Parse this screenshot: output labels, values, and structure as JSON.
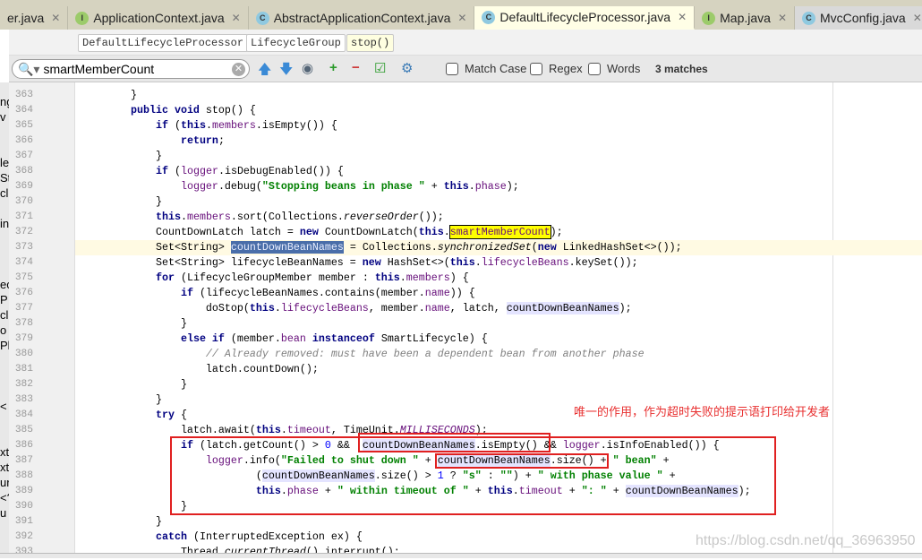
{
  "tabs": [
    {
      "label": "er.java",
      "icon": "none"
    },
    {
      "label": "ApplicationContext.java",
      "icon": "interface",
      "badge": "I"
    },
    {
      "label": "AbstractApplicationContext.java",
      "icon": "class",
      "badge": "C"
    },
    {
      "label": "DefaultLifecycleProcessor.java",
      "icon": "class",
      "badge": "C",
      "active": true
    },
    {
      "label": "Map.java",
      "icon": "interface",
      "badge": "I"
    },
    {
      "label": "MvcConfig.java",
      "icon": "class",
      "badge": "C"
    }
  ],
  "breadcrumbs": [
    "DefaultLifecycleProcessor",
    "LifecycleGroup",
    "stop()"
  ],
  "search": {
    "value": "smartMemberCount",
    "options": [
      "Match Case",
      "Regex",
      "Words"
    ],
    "matches": "3 matches"
  },
  "tree_fragments": [
    "ng",
    "v",
    "le",
    "St",
    "cl",
    "int",
    "ec",
    "P",
    "cl",
    "o",
    "Ph",
    "<",
    "xt",
    "xt",
    "ur",
    "<?",
    "u"
  ],
  "annotation": "唯一的作用，作为超时失败的提示语打印给开发者",
  "watermark": "https://blog.csdn.net/qq_36963950",
  "colors": {
    "keyword": "#000080",
    "field": "#660e7a",
    "string": "#008000",
    "number": "#0000ff",
    "comment": "#808080",
    "search_match": "#ffff00",
    "annotation": "#e83030"
  },
  "code": {
    "lines": [
      {
        "n": "363",
        "t": [
          [
            "",
            "    }"
          ]
        ]
      },
      {
        "n": "364",
        "t": [
          [
            "",
            "    "
          ],
          [
            "kw",
            "public void"
          ],
          [
            "",
            " stop() {"
          ]
        ]
      },
      {
        "n": "365",
        "t": [
          [
            "",
            "        "
          ],
          [
            "kw",
            "if"
          ],
          [
            "",
            " ("
          ],
          [
            "kw",
            "this"
          ],
          [
            "",
            "."
          ],
          [
            "fld",
            "members"
          ],
          [
            "",
            ".isEmpty()) {"
          ]
        ]
      },
      {
        "n": "366",
        "t": [
          [
            "",
            "            "
          ],
          [
            "kw",
            "return"
          ],
          [
            "",
            ";"
          ]
        ]
      },
      {
        "n": "367",
        "t": [
          [
            "",
            "        }"
          ]
        ]
      },
      {
        "n": "368",
        "t": [
          [
            "",
            "        "
          ],
          [
            "kw",
            "if"
          ],
          [
            "",
            " ("
          ],
          [
            "fld",
            "logger"
          ],
          [
            "",
            ".isDebugEnabled()) {"
          ]
        ]
      },
      {
        "n": "369",
        "t": [
          [
            "",
            "            "
          ],
          [
            "fld",
            "logger"
          ],
          [
            "",
            ".debug("
          ],
          [
            "str",
            "\"Stopping beans in phase \""
          ],
          [
            "",
            " + "
          ],
          [
            "kw",
            "this"
          ],
          [
            "",
            "."
          ],
          [
            "fld",
            "phase"
          ],
          [
            "",
            ");"
          ]
        ]
      },
      {
        "n": "370",
        "t": [
          [
            "",
            "        }"
          ]
        ]
      },
      {
        "n": "371",
        "t": [
          [
            "",
            "        "
          ],
          [
            "kw",
            "this"
          ],
          [
            "",
            "."
          ],
          [
            "fld",
            "members"
          ],
          [
            "",
            ".sort(Collections."
          ],
          [
            "it",
            "reverseOrder"
          ],
          [
            "",
            "());"
          ]
        ]
      },
      {
        "n": "372",
        "t": [
          [
            "",
            "        CountDownLatch latch = "
          ],
          [
            "kw",
            "new"
          ],
          [
            "",
            " CountDownLatch("
          ],
          [
            "kw",
            "this"
          ],
          [
            "",
            "."
          ],
          [
            "fld hl",
            "smartMemberCount"
          ],
          [
            "",
            ");"
          ]
        ]
      },
      {
        "n": "373",
        "current": true,
        "t": [
          [
            "",
            "        Set<String> "
          ],
          [
            "sel",
            "countDownBeanNames"
          ],
          [
            "",
            " = Collections."
          ],
          [
            "it",
            "synchronizedSet"
          ],
          [
            "",
            "("
          ],
          [
            "kw",
            "new"
          ],
          [
            "",
            " LinkedHashSet<>());"
          ]
        ]
      },
      {
        "n": "374",
        "t": [
          [
            "",
            "        Set<String> lifecycleBeanNames = "
          ],
          [
            "kw",
            "new"
          ],
          [
            "",
            " HashSet<>("
          ],
          [
            "kw",
            "this"
          ],
          [
            "",
            "."
          ],
          [
            "fld",
            "lifecycleBeans"
          ],
          [
            "",
            ".keySet());"
          ]
        ]
      },
      {
        "n": "375",
        "t": [
          [
            "",
            "        "
          ],
          [
            "kw",
            "for"
          ],
          [
            "",
            " (LifecycleGroupMember member : "
          ],
          [
            "kw",
            "this"
          ],
          [
            "",
            "."
          ],
          [
            "fld",
            "members"
          ],
          [
            "",
            ") {"
          ]
        ]
      },
      {
        "n": "376",
        "t": [
          [
            "",
            "            "
          ],
          [
            "kw",
            "if"
          ],
          [
            "",
            " (lifecycleBeanNames.contains(member."
          ],
          [
            "fld",
            "name"
          ],
          [
            "",
            ")) {"
          ]
        ]
      },
      {
        "n": "377",
        "t": [
          [
            "",
            "                doStop("
          ],
          [
            "kw",
            "this"
          ],
          [
            "",
            "."
          ],
          [
            "fld",
            "lifecycleBeans"
          ],
          [
            "",
            ", member."
          ],
          [
            "fld",
            "name"
          ],
          [
            "",
            ", latch, "
          ],
          [
            "use",
            "countDownBeanNames"
          ],
          [
            "",
            ");"
          ]
        ]
      },
      {
        "n": "378",
        "t": [
          [
            "",
            "            }"
          ]
        ]
      },
      {
        "n": "379",
        "t": [
          [
            "",
            "            "
          ],
          [
            "kw",
            "else if"
          ],
          [
            "",
            " (member."
          ],
          [
            "fld",
            "bean"
          ],
          [
            "",
            " "
          ],
          [
            "kw",
            "instanceof"
          ],
          [
            "",
            " SmartLifecycle) {"
          ]
        ]
      },
      {
        "n": "380",
        "t": [
          [
            "",
            "                "
          ],
          [
            "cm",
            "// Already removed: must have been a dependent bean from another phase"
          ]
        ]
      },
      {
        "n": "381",
        "t": [
          [
            "",
            "                latch.countDown();"
          ]
        ]
      },
      {
        "n": "382",
        "t": [
          [
            "",
            "            }"
          ]
        ]
      },
      {
        "n": "383",
        "t": [
          [
            "",
            "        }"
          ]
        ]
      },
      {
        "n": "384",
        "t": [
          [
            "",
            "        "
          ],
          [
            "kw",
            "try"
          ],
          [
            "",
            " {"
          ]
        ]
      },
      {
        "n": "385",
        "t": [
          [
            "",
            "            latch.await("
          ],
          [
            "kw",
            "this"
          ],
          [
            "",
            "."
          ],
          [
            "fld",
            "timeout"
          ],
          [
            "",
            ", TimeUnit."
          ],
          [
            "itf",
            "MILLISECONDS"
          ],
          [
            "",
            ");"
          ]
        ]
      },
      {
        "n": "386",
        "t": [
          [
            "",
            "            "
          ],
          [
            "kw",
            "if"
          ],
          [
            "",
            " (latch.getCount() > "
          ],
          [
            "num",
            "0"
          ],
          [
            "",
            " && !"
          ],
          [
            "use",
            "countDownBeanNames"
          ],
          [
            "",
            ".isEmpty() && "
          ],
          [
            "fld",
            "logger"
          ],
          [
            "",
            ".isInfoEnabled()) {"
          ]
        ]
      },
      {
        "n": "387",
        "t": [
          [
            "",
            "                "
          ],
          [
            "fld",
            "logger"
          ],
          [
            "",
            ".info("
          ],
          [
            "str",
            "\"Failed to shut down \""
          ],
          [
            "",
            " + "
          ],
          [
            "use",
            "countDownBeanNames"
          ],
          [
            "",
            ".size() + "
          ],
          [
            "str",
            "\" bean\""
          ],
          [
            "",
            " +"
          ]
        ]
      },
      {
        "n": "388",
        "t": [
          [
            "",
            "                        ("
          ],
          [
            "use",
            "countDownBeanNames"
          ],
          [
            "",
            ".size() > "
          ],
          [
            "num",
            "1"
          ],
          [
            "",
            " ? "
          ],
          [
            "str",
            "\"s\""
          ],
          [
            "",
            " : "
          ],
          [
            "str",
            "\"\""
          ],
          [
            "",
            ") + "
          ],
          [
            "str",
            "\" with phase value \""
          ],
          [
            "",
            " +"
          ]
        ]
      },
      {
        "n": "389",
        "t": [
          [
            "",
            "                        "
          ],
          [
            "kw",
            "this"
          ],
          [
            "",
            "."
          ],
          [
            "fld",
            "phase"
          ],
          [
            "",
            " + "
          ],
          [
            "str",
            "\" within timeout of \""
          ],
          [
            "",
            " + "
          ],
          [
            "kw",
            "this"
          ],
          [
            "",
            "."
          ],
          [
            "fld",
            "timeout"
          ],
          [
            "",
            " + "
          ],
          [
            "str",
            "\": \""
          ],
          [
            "",
            " + "
          ],
          [
            "use",
            "countDownBeanNames"
          ],
          [
            "",
            ");"
          ]
        ]
      },
      {
        "n": "390",
        "t": [
          [
            "",
            "            }"
          ]
        ]
      },
      {
        "n": "391",
        "t": [
          [
            "",
            "        }"
          ]
        ]
      },
      {
        "n": "392",
        "t": [
          [
            "",
            "        "
          ],
          [
            "kw",
            "catch"
          ],
          [
            "",
            " (InterruptedException ex) {"
          ]
        ]
      },
      {
        "n": "393",
        "t": [
          [
            "",
            "            Thread."
          ],
          [
            "it",
            "currentThread"
          ],
          [
            "",
            "().interrupt();"
          ]
        ]
      }
    ]
  }
}
